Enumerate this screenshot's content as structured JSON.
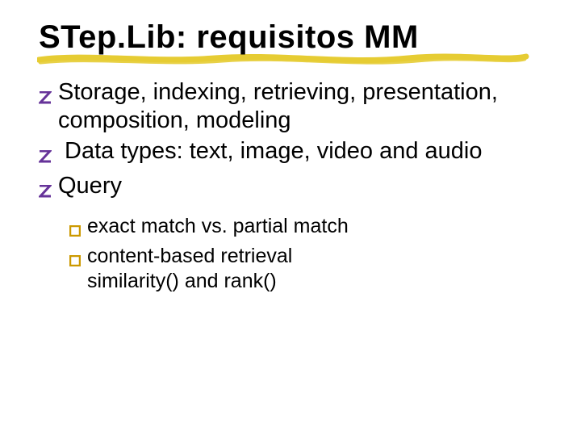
{
  "title": "STep.Lib: requisitos MM",
  "bullets": [
    {
      "text": "Storage, indexing, retrieving, presentation, composition, modeling",
      "spaced": false
    },
    {
      "text": "Data types: text, image, video and audio",
      "spaced": true
    },
    {
      "text": "Query",
      "spaced": false
    }
  ],
  "sub_bullets": [
    {
      "text": "exact match vs. partial match"
    },
    {
      "text": "content-based retrieval\nsimilarity()  and rank()"
    }
  ],
  "colors": {
    "z_bullet": "#663399",
    "y_bullet": "#cc9900",
    "underline": "#e6cc33"
  }
}
